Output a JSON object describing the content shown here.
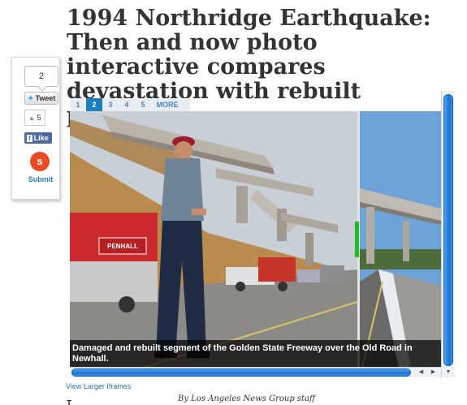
{
  "headline": "1994 Northridge Earthquake: Then and now photo interactive compares devastation with rebuilt present",
  "share": {
    "tweet_count": "2",
    "tweet_label": "Tweet",
    "like_count": "5",
    "like_label": "Like",
    "stumble_label": "Submit"
  },
  "tabs": [
    {
      "label": "1",
      "active": false
    },
    {
      "label": "2",
      "active": true
    },
    {
      "label": "3",
      "active": false
    },
    {
      "label": "4",
      "active": false
    },
    {
      "label": "5",
      "active": false
    },
    {
      "label": "MORE",
      "active": false
    }
  ],
  "viewer": {
    "caption": "Damaged and rebuilt segment of the Golden State Freeway over the Old Road in Newhall.",
    "truck_text": "PENHALL"
  },
  "larger_link": "View Larger Iframes",
  "byline": "By Los Angeles News Group staff",
  "cut_text": "T"
}
